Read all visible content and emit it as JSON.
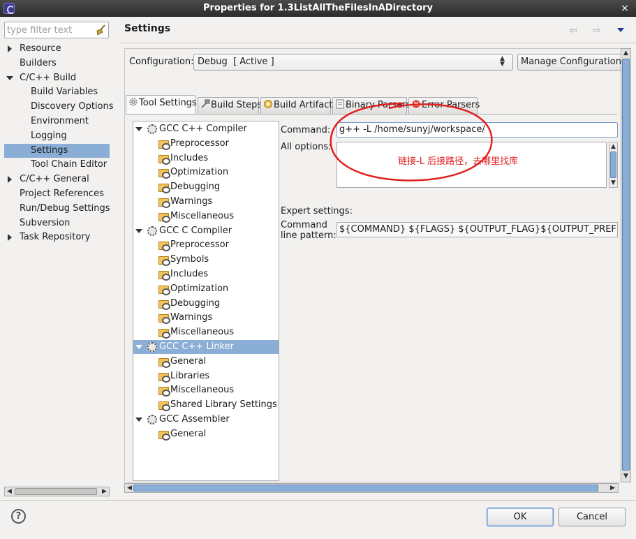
{
  "window": {
    "title": "Properties for 1.3ListAllTheFilesInADirectory",
    "close": "×"
  },
  "filter": {
    "placeholder": "type filter text"
  },
  "nav": [
    {
      "label": "Resource",
      "expander": "collapsed"
    },
    {
      "label": "Builders"
    },
    {
      "label": "C/C++ Build",
      "expander": "expanded"
    },
    {
      "label": "Build Variables"
    },
    {
      "label": "Discovery Options"
    },
    {
      "label": "Environment"
    },
    {
      "label": "Logging"
    },
    {
      "label": "Settings",
      "selected": true
    },
    {
      "label": "Tool Chain Editor"
    },
    {
      "label": "C/C++ General",
      "expander": "collapsed"
    },
    {
      "label": "Project References"
    },
    {
      "label": "Run/Debug Settings"
    },
    {
      "label": "Subversion"
    },
    {
      "label": "Task Repository",
      "expander": "collapsed"
    }
  ],
  "header": {
    "title": "Settings",
    "back": "⇦",
    "forward": "⇨"
  },
  "configuration": {
    "label": "Configuration:",
    "value": "Debug  [ Active ]",
    "manage_label": "Manage Configurations..."
  },
  "tabs": [
    {
      "label": "Tool Settings",
      "icon": "tool-settings-icon",
      "active": true
    },
    {
      "label": "Build Steps",
      "icon": "build-steps-icon"
    },
    {
      "label": "Build Artifact",
      "icon": "build-artifact-icon"
    },
    {
      "label": "Binary Parsers",
      "icon": "binary-parsers-icon"
    },
    {
      "label": "Error Parsers",
      "icon": "error-parsers-icon"
    }
  ],
  "tree": [
    {
      "label": "GCC C++ Compiler",
      "type": "tool"
    },
    {
      "label": "Preprocessor",
      "type": "category"
    },
    {
      "label": "Includes",
      "type": "category"
    },
    {
      "label": "Optimization",
      "type": "category"
    },
    {
      "label": "Debugging",
      "type": "category"
    },
    {
      "label": "Warnings",
      "type": "category"
    },
    {
      "label": "Miscellaneous",
      "type": "category"
    },
    {
      "label": "GCC C Compiler",
      "type": "tool"
    },
    {
      "label": "Preprocessor",
      "type": "category"
    },
    {
      "label": "Symbols",
      "type": "category"
    },
    {
      "label": "Includes",
      "type": "category"
    },
    {
      "label": "Optimization",
      "type": "category"
    },
    {
      "label": "Debugging",
      "type": "category"
    },
    {
      "label": "Warnings",
      "type": "category"
    },
    {
      "label": "Miscellaneous",
      "type": "category"
    },
    {
      "label": "GCC C++ Linker",
      "type": "tool",
      "selected": true
    },
    {
      "label": "General",
      "type": "category"
    },
    {
      "label": "Libraries",
      "type": "category"
    },
    {
      "label": "Miscellaneous",
      "type": "category"
    },
    {
      "label": "Shared Library Settings",
      "type": "category"
    },
    {
      "label": "GCC Assembler",
      "type": "tool"
    },
    {
      "label": "General",
      "type": "category"
    }
  ],
  "options": {
    "command_label": "Command:",
    "command_value": "g++ -L /home/sunyj/workspace/",
    "all_options_label": "All options:",
    "all_options_value": "",
    "annotation": "链接-L 后接路径，去哪里找库",
    "expert_label": "Expert settings:",
    "pattern_label_1": "Command",
    "pattern_label_2": "line pattern:",
    "pattern_value": "${COMMAND} ${FLAGS} ${OUTPUT_FLAG}${OUTPUT_PREFIX}${OUTPUT}"
  },
  "buttons": {
    "help": "?",
    "ok": "OK",
    "cancel": "Cancel"
  },
  "colors": {
    "selection": "#8aaed5",
    "annotation": "#e02020",
    "window_bg": "#f2f1f0"
  }
}
